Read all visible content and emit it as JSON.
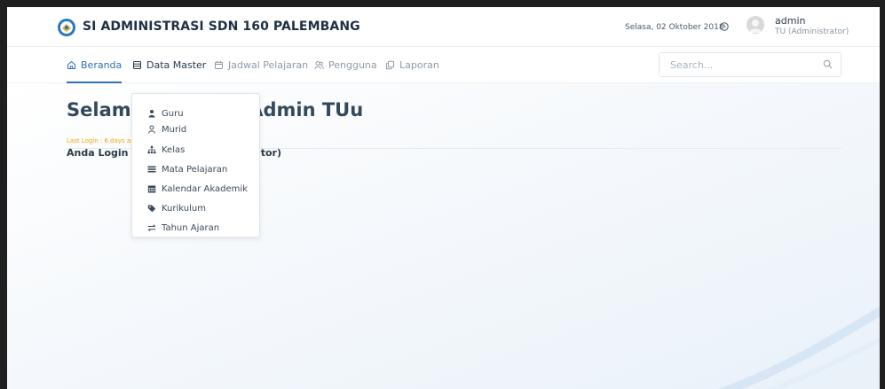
{
  "header": {
    "app_title": "SI ADMINISTRASI SDN 160 PALEMBANG",
    "date": "Selasa, 02 Oktober 2018",
    "user": {
      "name": "admin",
      "role": "TU (Administrator)"
    }
  },
  "nav": {
    "items": [
      {
        "label": "Beranda",
        "icon": "home-icon"
      },
      {
        "label": "Data Master",
        "icon": "database-icon"
      },
      {
        "label": "Jadwal Pelajaran",
        "icon": "calendar-icon"
      },
      {
        "label": "Pengguna",
        "icon": "users-icon"
      },
      {
        "label": "Laporan",
        "icon": "copy-icon"
      }
    ],
    "active": "Beranda",
    "open": "Data Master"
  },
  "search": {
    "placeholder": "Search..."
  },
  "content": {
    "welcome": "Selamat Datang, Admin TUu",
    "last_login": "Last Login : 6 days ago",
    "login_as": "Anda Login sebagai TU (Administrator)"
  },
  "dropdown": {
    "items": [
      {
        "label": "Guru",
        "icon": "user-icon"
      },
      {
        "label": "Murid",
        "icon": "user-outline-icon"
      },
      {
        "label": "Kelas",
        "icon": "sitemap-icon"
      },
      {
        "label": "Mata Pelajaran",
        "icon": "list-icon"
      },
      {
        "label": "Kalendar Akademik",
        "icon": "calendar-grid-icon"
      },
      {
        "label": "Kurikulum",
        "icon": "tag-icon"
      },
      {
        "label": "Tahun Ajaran",
        "icon": "exchange-icon"
      }
    ]
  },
  "colors": {
    "accent": "#2f6fb4",
    "last_login": "#f0a30a",
    "title": "#1f3044"
  }
}
